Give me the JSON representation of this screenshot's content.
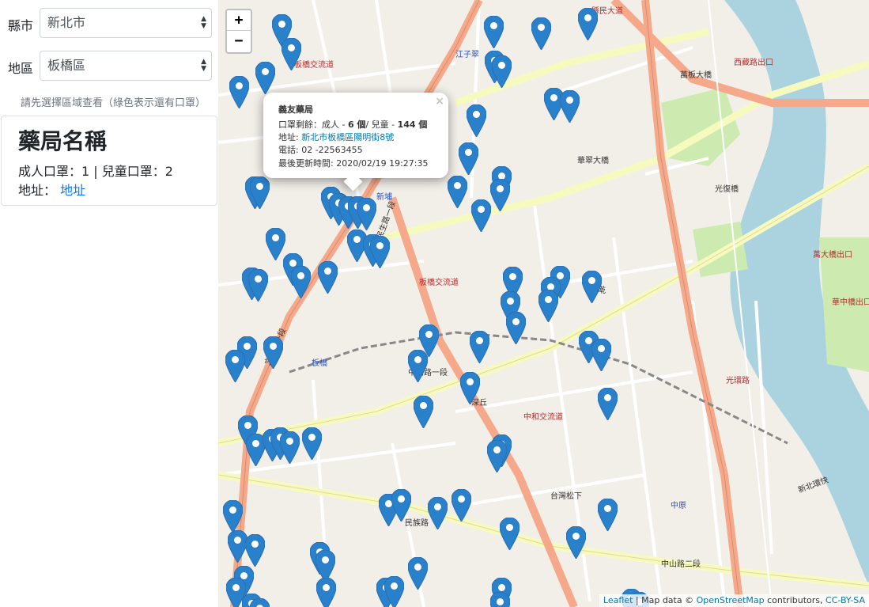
{
  "sidebar": {
    "city": {
      "label": "縣市",
      "value": "新北市"
    },
    "district": {
      "label": "地區",
      "value": "板橋區"
    },
    "hint": "請先選擇區域查看（綠色表示還有口罩）",
    "card": {
      "title": "藥局名稱",
      "masks_text": "成人口罩：1 | 兒童口罩：2",
      "address_label": "地址：",
      "address_link": "地址"
    }
  },
  "map": {
    "zoom_in": "+",
    "zoom_out": "−",
    "marker_color": "#2a81cb",
    "road_colors": {
      "primary": "#f5a98a",
      "secondary": "#f7fabf",
      "rail": "#888888",
      "river": "#aad3df",
      "park": "#cdebb0"
    },
    "labels": [
      {
        "text": "縣民大道"
      },
      {
        "text": "萬板大橋"
      },
      {
        "text": "西藏路出口"
      },
      {
        "text": "板橋交流道"
      },
      {
        "text": "江子翠"
      },
      {
        "text": "華翠大橋"
      },
      {
        "text": "光復橋"
      },
      {
        "text": "新埔"
      },
      {
        "text": "板橋交流道"
      },
      {
        "text": "埔墘"
      },
      {
        "text": "板橋"
      },
      {
        "text": "深丘"
      },
      {
        "text": "中和交流道"
      },
      {
        "text": "台灣松下"
      },
      {
        "text": "中原"
      },
      {
        "text": "光環路"
      },
      {
        "text": "萬大橋出口"
      },
      {
        "text": "華中橋出口"
      },
      {
        "text": "民族路"
      },
      {
        "text": "中山路一段"
      },
      {
        "text": "中山路二段"
      },
      {
        "text": "民生路一段"
      },
      {
        "text": "文化路一段"
      },
      {
        "text": "新北環快"
      }
    ],
    "popup": {
      "name": "義友藥局",
      "mask_prefix": "口罩剩餘：成人 - ",
      "adult": "6 個",
      "mask_mid": "/ 兒童 - ",
      "child": "144 個",
      "address_label": "地址: ",
      "address": "新北市板橋區陽明街8號",
      "phone": "電話: 02 -22563455",
      "updated": "最後更新時間: 2020/02/19 19:27:35",
      "close": "×"
    },
    "attribution": {
      "leaflet": "Leaflet",
      "sep": " | Map data © ",
      "osm": "OpenStreetMap",
      "mid": " contributors, ",
      "license": "CC-BY-SA"
    }
  }
}
